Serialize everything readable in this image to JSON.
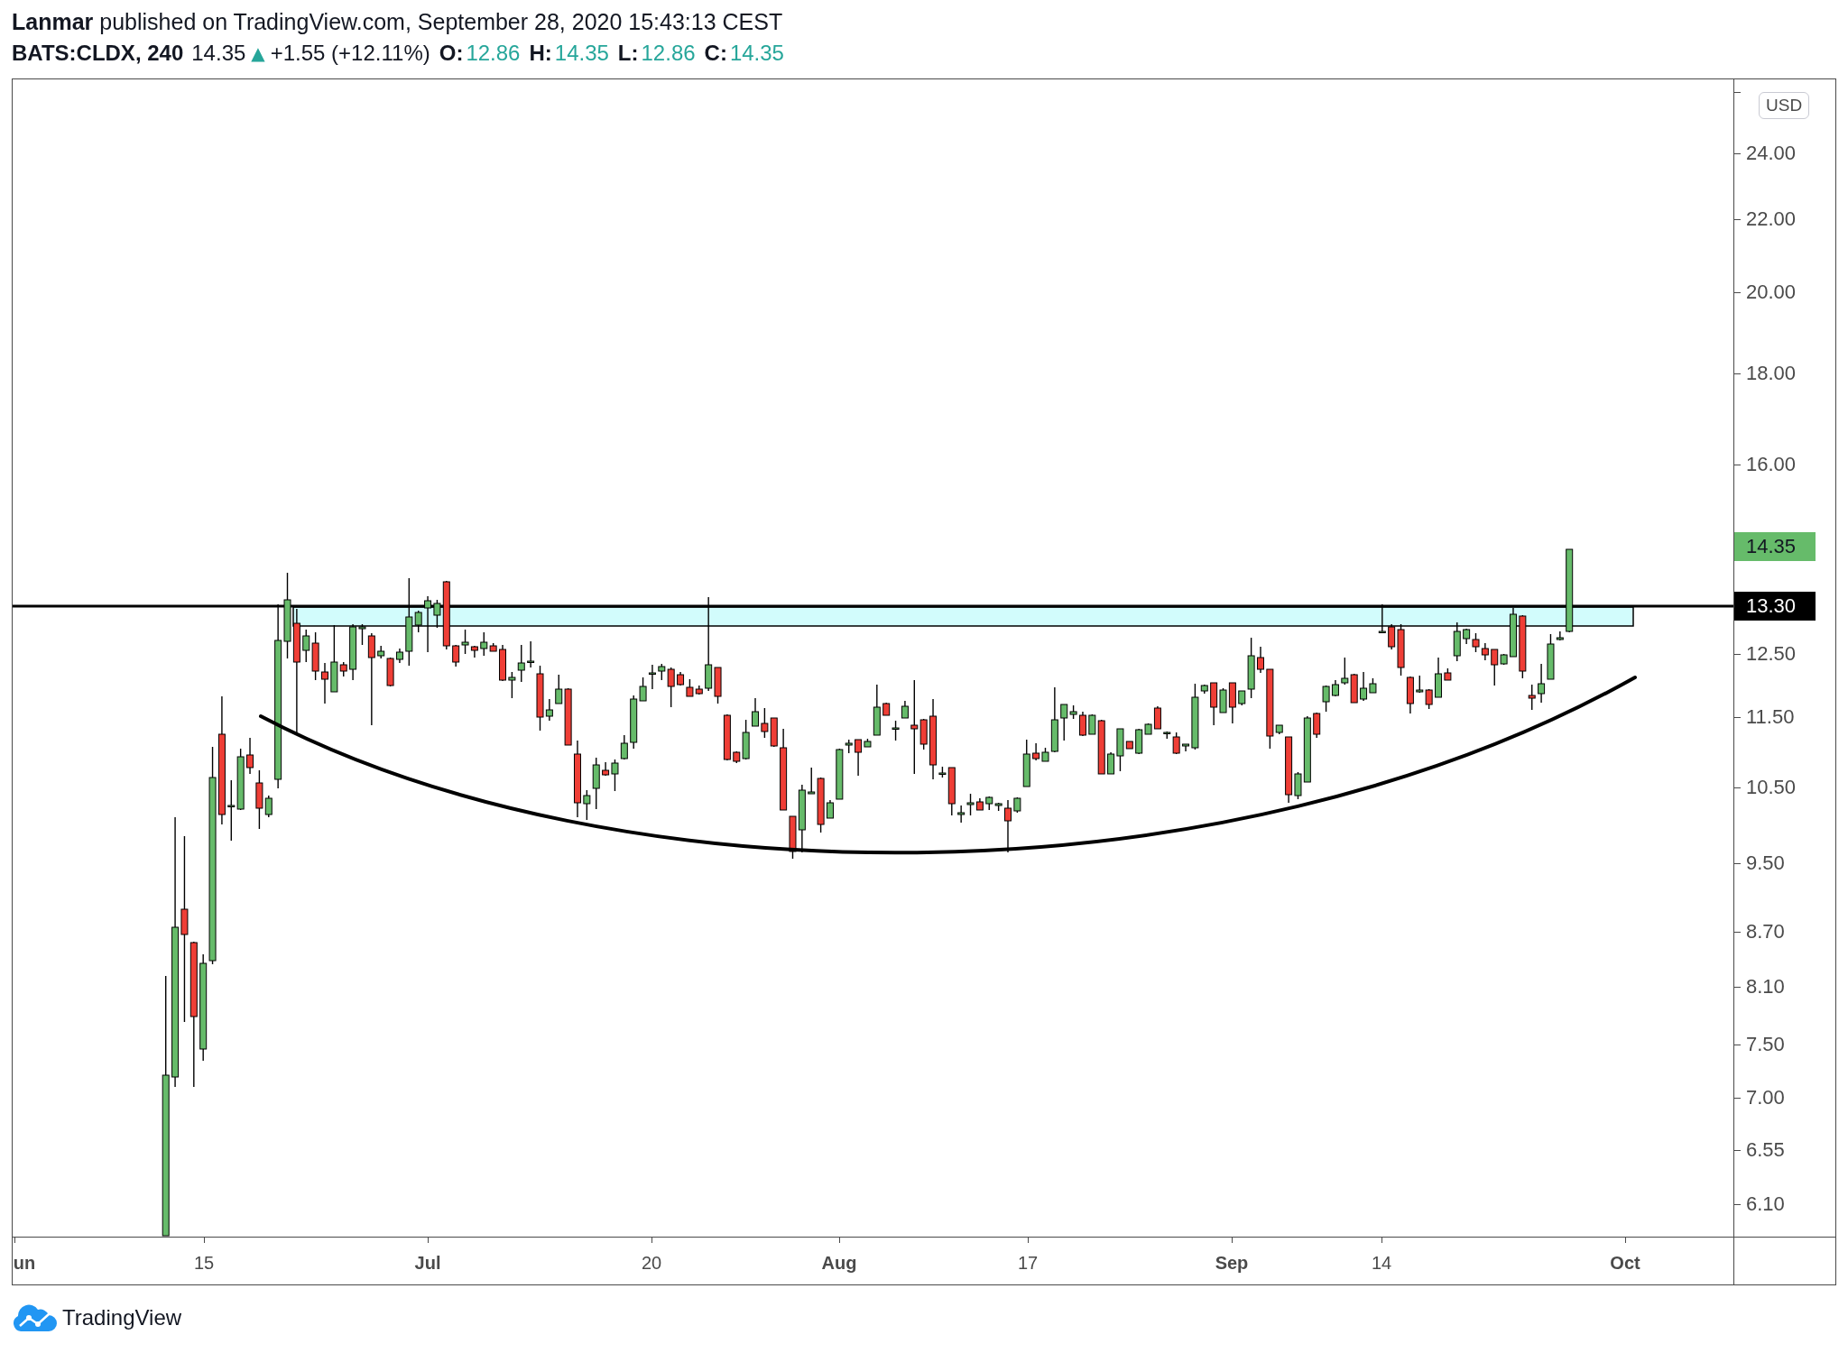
{
  "header": {
    "publish_info": "**Lanmar** published on TradingView.com, September 28, 2020 15:43:13 CEST"
  },
  "legend": {
    "symbol": "BATS:CLDX, 240",
    "last_price": "14.35",
    "arrow": "▲",
    "change": "+1.55 (+12.11%)",
    "ohlc": [
      {
        "label": "O:",
        "value": "12.86"
      },
      {
        "label": "H:",
        "value": "14.35"
      },
      {
        "label": "L:",
        "value": "12.86"
      },
      {
        "label": "C:",
        "value": "14.35"
      }
    ]
  },
  "chart": {
    "currency": "USD",
    "price_axis": {
      "labels": [
        "24.00",
        "22.00",
        "20.00",
        "18.00",
        "16.00",
        "12.50",
        "11.50",
        "10.50",
        "9.50",
        "8.70",
        "8.10",
        "7.50",
        "7.00",
        "6.55",
        "6.10"
      ]
    },
    "price_badges": [
      {
        "kind": "last_price",
        "text": "14.35"
      },
      {
        "kind": "line",
        "text": "13.30"
      }
    ],
    "time_axis": {
      "labels": [
        {
          "kind": "month",
          "text": "un"
        },
        {
          "kind": "day",
          "text": "15"
        },
        {
          "kind": "month",
          "text": "Jul"
        },
        {
          "kind": "day",
          "text": "20"
        },
        {
          "kind": "month",
          "text": "Aug"
        },
        {
          "kind": "day",
          "text": "17"
        },
        {
          "kind": "month",
          "text": "Sep"
        },
        {
          "kind": "day",
          "text": "14"
        },
        {
          "kind": "month",
          "text": "Oct"
        }
      ]
    }
  },
  "footer": {
    "logo_text": "TradingView"
  }
}
